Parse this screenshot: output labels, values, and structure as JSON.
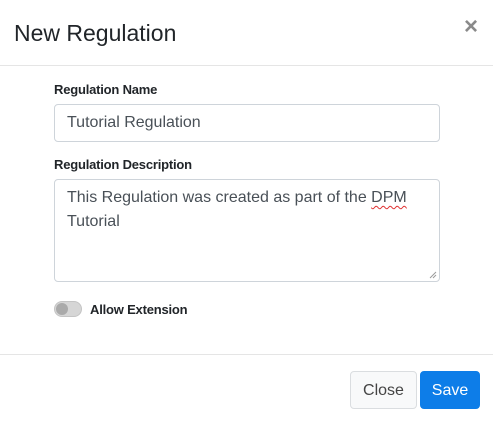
{
  "dialog": {
    "title": "New Regulation",
    "close_icon": "close-icon",
    "close_glyph": "×"
  },
  "form": {
    "name_label": "Regulation Name",
    "name_value": "Tutorial Regulation",
    "description_label": "Regulation Description",
    "description_value_part1": "This Regulation was created as part of the ",
    "description_value_spellcheck": "DPM",
    "description_value_part2": "Tutorial",
    "allow_extension_label": "Allow Extension",
    "allow_extension_enabled": false
  },
  "footer": {
    "close_label": "Close",
    "save_label": "Save"
  },
  "colors": {
    "primary": "#0d7de8",
    "secondary_bg": "#f8f9fa",
    "toggle_off": "#d6d6d6",
    "spellcheck_underline": "#e03030"
  }
}
